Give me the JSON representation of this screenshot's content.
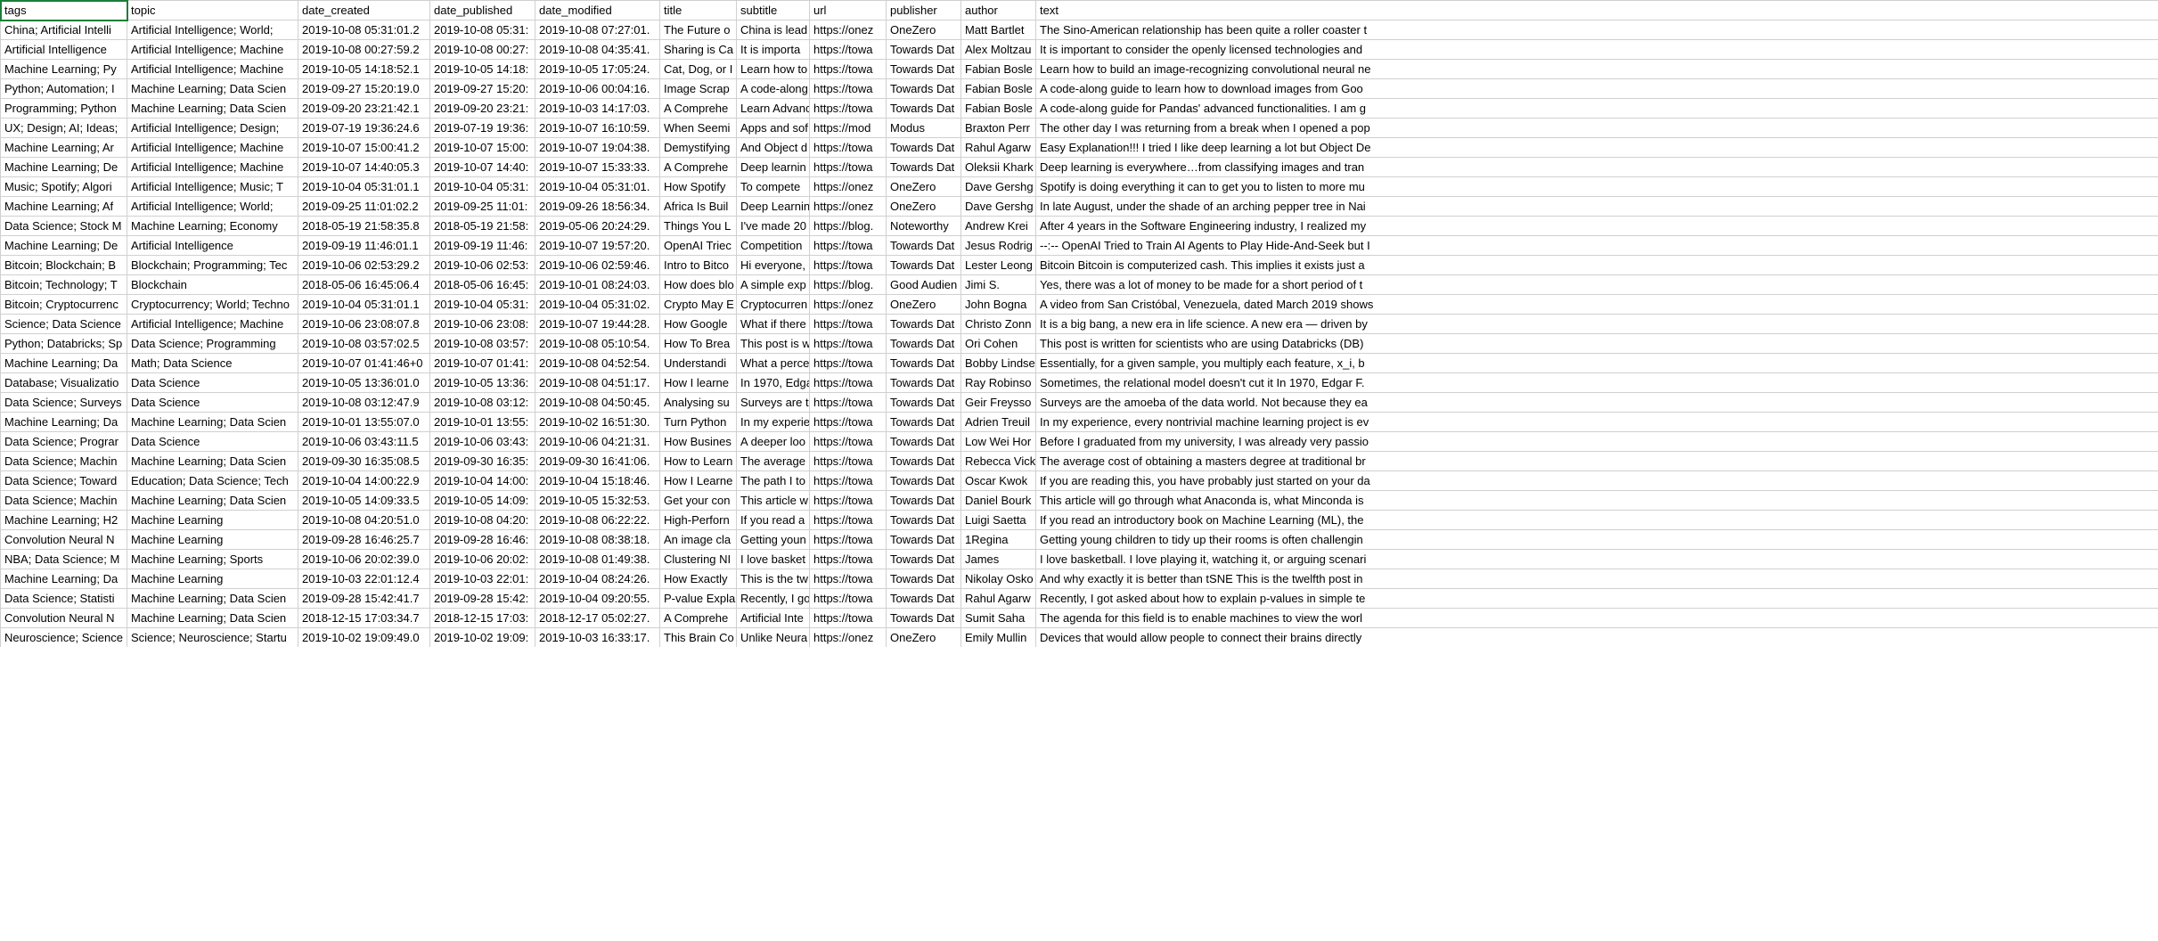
{
  "headers": {
    "tags": "tags",
    "topic": "topic",
    "date_created": "date_created",
    "date_published": "date_published",
    "date_modified": "date_modified",
    "title": "title",
    "subtitle": "subtitle",
    "url": "url",
    "publisher": "publisher",
    "author": "author",
    "text": "text"
  },
  "rows": [
    {
      "tags": "China; Artificial Intelli",
      "topic": "Artificial Intelligence; World;",
      "date_created": "2019-10-08 05:31:01.2",
      "date_published": "2019-10-08 05:31:",
      "date_modified": "2019-10-08 07:27:01.",
      "title": "The Future o",
      "subtitle": "China is lead",
      "url": "https://onez",
      "publisher": "OneZero",
      "author": "Matt Bartlet",
      "text": "The Sino-American relationship has been quite a roller coaster t"
    },
    {
      "tags": "Artificial Intelligence",
      "topic": "Artificial Intelligence; Machine",
      "date_created": "2019-10-08 00:27:59.2",
      "date_published": "2019-10-08 00:27:",
      "date_modified": "2019-10-08 04:35:41.",
      "title": "Sharing is Ca",
      "subtitle": "It is importa",
      "url": "https://towa",
      "publisher": "Towards Dat",
      "author": "Alex Moltzau",
      "text": "It is important to consider the openly licensed technologies and"
    },
    {
      "tags": "Machine Learning; Py",
      "topic": "Artificial Intelligence; Machine",
      "date_created": "2019-10-05 14:18:52.1",
      "date_published": "2019-10-05 14:18:",
      "date_modified": "2019-10-05 17:05:24.",
      "title": "Cat, Dog, or I",
      "subtitle": "Learn how to",
      "url": "https://towa",
      "publisher": "Towards Dat",
      "author": "Fabian Bosle",
      "text": "Learn how to build an image-recognizing convolutional neural ne"
    },
    {
      "tags": "Python; Automation; I",
      "topic": "Machine Learning; Data Scien",
      "date_created": "2019-09-27 15:20:19.0",
      "date_published": "2019-09-27 15:20:",
      "date_modified": "2019-10-06 00:04:16.",
      "title": "Image Scrap",
      "subtitle": "A code-along",
      "url": "https://towa",
      "publisher": "Towards Dat",
      "author": "Fabian Bosle",
      "text": "A code-along guide to learn how to download images from Goo"
    },
    {
      "tags": "Programming; Python",
      "topic": "Machine Learning; Data Scien",
      "date_created": "2019-09-20 23:21:42.1",
      "date_published": "2019-09-20 23:21:",
      "date_modified": "2019-10-03 14:17:03.",
      "title": "A Comprehe",
      "subtitle": "Learn Advanc",
      "url": "https://towa",
      "publisher": "Towards Dat",
      "author": "Fabian Bosle",
      "text": "A code-along guide for Pandas' advanced functionalities. I am g"
    },
    {
      "tags": "UX; Design; AI; Ideas;",
      "topic": "Artificial Intelligence; Design;",
      "date_created": "2019-07-19 19:36:24.6",
      "date_published": "2019-07-19 19:36:",
      "date_modified": "2019-10-07 16:10:59.",
      "title": "When Seemi",
      "subtitle": "Apps and sof",
      "url": "https://mod",
      "publisher": "Modus",
      "author": "Braxton Perr",
      "text": "The other day I was returning from a break when I opened a pop"
    },
    {
      "tags": "Machine Learning; Ar",
      "topic": "Artificial Intelligence; Machine",
      "date_created": "2019-10-07 15:00:41.2",
      "date_published": "2019-10-07 15:00:",
      "date_modified": "2019-10-07 19:04:38.",
      "title": "Demystifying",
      "subtitle": "And Object d",
      "url": "https://towa",
      "publisher": "Towards Dat",
      "author": "Rahul Agarw",
      "text": "Easy Explanation!!! I tried I like deep learning a lot but Object De"
    },
    {
      "tags": "Machine Learning; De",
      "topic": "Artificial Intelligence; Machine",
      "date_created": "2019-10-07 14:40:05.3",
      "date_published": "2019-10-07 14:40:",
      "date_modified": "2019-10-07 15:33:33.",
      "title": "A Comprehe",
      "subtitle": "Deep learnin",
      "url": "https://towa",
      "publisher": "Towards Dat",
      "author": "Oleksii Khark",
      "text": "Deep learning is everywhere…from classifying images and tran"
    },
    {
      "tags": "Music; Spotify; Algori",
      "topic": "Artificial Intelligence; Music; T",
      "date_created": "2019-10-04 05:31:01.1",
      "date_published": "2019-10-04 05:31:",
      "date_modified": "2019-10-04 05:31:01.",
      "title": "How Spotify",
      "subtitle": "To compete",
      "url": "https://onez",
      "publisher": "OneZero",
      "author": "Dave Gershg",
      "text": "Spotify is doing everything it can to get you to listen to more mu"
    },
    {
      "tags": "Machine Learning; Af",
      "topic": "Artificial Intelligence; World;",
      "date_created": "2019-09-25 11:01:02.2",
      "date_published": "2019-09-25 11:01:",
      "date_modified": "2019-09-26 18:56:34.",
      "title": "Africa Is Buil",
      "subtitle": "Deep Learnin",
      "url": "https://onez",
      "publisher": "OneZero",
      "author": "Dave Gershg",
      "text": "In late August, under the shade of an arching pepper tree in Nai"
    },
    {
      "tags": "Data Science; Stock M",
      "topic": "Machine Learning; Economy",
      "date_created": "2018-05-19 21:58:35.8",
      "date_published": "2018-05-19 21:58:",
      "date_modified": "2019-05-06 20:24:29.",
      "title": "Things You L",
      "subtitle": "I've made 20",
      "url": "https://blog.",
      "publisher": "Noteworthy",
      "author": "Andrew Krei",
      "text": "After 4 years in the Software Engineering industry, I realized my"
    },
    {
      "tags": "Machine Learning; De",
      "topic": "Artificial Intelligence",
      "date_created": "2019-09-19 11:46:01.1",
      "date_published": "2019-09-19 11:46:",
      "date_modified": "2019-10-07 19:57:20.",
      "title": "OpenAI Triec",
      "subtitle": "Competition",
      "url": "https://towa",
      "publisher": "Towards Dat",
      "author": "Jesus Rodrig",
      "text": "--:-- OpenAI Tried to Train AI Agents to Play Hide-And-Seek but I"
    },
    {
      "tags": "Bitcoin; Blockchain; B",
      "topic": "Blockchain; Programming; Tec",
      "date_created": "2019-10-06 02:53:29.2",
      "date_published": "2019-10-06 02:53:",
      "date_modified": "2019-10-06 02:59:46.",
      "title": "Intro to Bitco",
      "subtitle": "Hi everyone,",
      "url": "https://towa",
      "publisher": "Towards Dat",
      "author": "Lester Leong",
      "text": "Bitcoin Bitcoin is computerized cash. This implies it exists just a"
    },
    {
      "tags": "Bitcoin; Technology; T",
      "topic": "Blockchain",
      "date_created": "2018-05-06 16:45:06.4",
      "date_published": "2018-05-06 16:45:",
      "date_modified": "2019-10-01 08:24:03.",
      "title": "How does blo",
      "subtitle": "A simple exp",
      "url": "https://blog.",
      "publisher": "Good Audien",
      "author": "Jimi S.",
      "text": "Yes, there was a lot of money to be made for a short period of t"
    },
    {
      "tags": "Bitcoin; Cryptocurrenc",
      "topic": "Cryptocurrency; World; Techno",
      "date_created": "2019-10-04 05:31:01.1",
      "date_published": "2019-10-04 05:31:",
      "date_modified": "2019-10-04 05:31:02.",
      "title": "Crypto May E",
      "subtitle": "Cryptocurren",
      "url": "https://onez",
      "publisher": "OneZero",
      "author": "John Bogna",
      "text": "A video from San Cristóbal, Venezuela, dated March 2019 shows"
    },
    {
      "tags": "Science; Data Science",
      "topic": "Artificial Intelligence; Machine",
      "date_created": "2019-10-06 23:08:07.8",
      "date_published": "2019-10-06 23:08:",
      "date_modified": "2019-10-07 19:44:28.",
      "title": "How Google",
      "subtitle": "What if there",
      "url": "https://towa",
      "publisher": "Towards Dat",
      "author": "Christo Zonn",
      "text": "It is a big bang, a new era in life science. A new era — driven by"
    },
    {
      "tags": "Python; Databricks; Sp",
      "topic": "Data Science; Programming",
      "date_created": "2019-10-08 03:57:02.5",
      "date_published": "2019-10-08 03:57:",
      "date_modified": "2019-10-08 05:10:54.",
      "title": "How To Brea",
      "subtitle": "This post is w",
      "url": "https://towa",
      "publisher": "Towards Dat",
      "author": "Ori Cohen",
      "text": "This post is written for scientists who are using Databricks (DB)"
    },
    {
      "tags": "Machine Learning; Da",
      "topic": "Math; Data Science",
      "date_created": "2019-10-07 01:41:46+0",
      "date_published": "2019-10-07 01:41:",
      "date_modified": "2019-10-08 04:52:54.",
      "title": "Understandi",
      "subtitle": "What a perce",
      "url": "https://towa",
      "publisher": "Towards Dat",
      "author": "Bobby Lindse",
      "text": "Essentially, for a given sample, you multiply each feature, x_i, b"
    },
    {
      "tags": "Database; Visualizatio",
      "topic": "Data Science",
      "date_created": "2019-10-05 13:36:01.0",
      "date_published": "2019-10-05 13:36:",
      "date_modified": "2019-10-08 04:51:17.",
      "title": "How I learne",
      "subtitle": "In 1970, Edga",
      "url": "https://towa",
      "publisher": "Towards Dat",
      "author": "Ray Robinso",
      "text": "Sometimes, the relational model doesn't cut it In 1970, Edgar F."
    },
    {
      "tags": "Data Science; Surveys",
      "topic": "Data Science",
      "date_created": "2019-10-08 03:12:47.9",
      "date_published": "2019-10-08 03:12:",
      "date_modified": "2019-10-08 04:50:45.",
      "title": "Analysing su",
      "subtitle": "Surveys are t",
      "url": "https://towa",
      "publisher": "Towards Dat",
      "author": "Geir Freysso",
      "text": "Surveys are the amoeba of the data world. Not because they ea"
    },
    {
      "tags": "Machine Learning; Da",
      "topic": "Machine Learning; Data Scien",
      "date_created": "2019-10-01 13:55:07.0",
      "date_published": "2019-10-01 13:55:",
      "date_modified": "2019-10-02 16:51:30.",
      "title": "Turn Python",
      "subtitle": "In my experie",
      "url": "https://towa",
      "publisher": "Towards Dat",
      "author": "Adrien Treuil",
      "text": "In my experience, every nontrivial machine learning project is ev"
    },
    {
      "tags": "Data Science; Prograr",
      "topic": "Data Science",
      "date_created": "2019-10-06 03:43:11.5",
      "date_published": "2019-10-06 03:43:",
      "date_modified": "2019-10-06 04:21:31.",
      "title": "How Busines",
      "subtitle": "A deeper loo",
      "url": "https://towa",
      "publisher": "Towards Dat",
      "author": "Low Wei Hor",
      "text": "Before I graduated from my university, I was already very passio"
    },
    {
      "tags": "Data Science; Machin",
      "topic": "Machine Learning; Data Scien",
      "date_created": "2019-09-30 16:35:08.5",
      "date_published": "2019-09-30 16:35:",
      "date_modified": "2019-09-30 16:41:06.",
      "title": "How to Learn",
      "subtitle": "The average",
      "url": "https://towa",
      "publisher": "Towards Dat",
      "author": "Rebecca Vick",
      "text": "The average cost of obtaining a masters degree at traditional br"
    },
    {
      "tags": "Data Science; Toward",
      "topic": "Education; Data Science; Tech",
      "date_created": "2019-10-04 14:00:22.9",
      "date_published": "2019-10-04 14:00:",
      "date_modified": "2019-10-04 15:18:46.",
      "title": "How I Learne",
      "subtitle": "The path I to",
      "url": "https://towa",
      "publisher": "Towards Dat",
      "author": "Oscar Kwok",
      "text": "If you are reading this, you have probably just started on your da"
    },
    {
      "tags": "Data Science; Machin",
      "topic": "Machine Learning; Data Scien",
      "date_created": "2019-10-05 14:09:33.5",
      "date_published": "2019-10-05 14:09:",
      "date_modified": "2019-10-05 15:32:53.",
      "title": "Get your con",
      "subtitle": "This article w",
      "url": "https://towa",
      "publisher": "Towards Dat",
      "author": "Daniel Bourk",
      "text": "This article will go through what Anaconda is, what Minconda is"
    },
    {
      "tags": "Machine Learning; H2",
      "topic": "Machine Learning",
      "date_created": "2019-10-08 04:20:51.0",
      "date_published": "2019-10-08 04:20:",
      "date_modified": "2019-10-08 06:22:22.",
      "title": "High-Perforn",
      "subtitle": "If you read a",
      "url": "https://towa",
      "publisher": "Towards Dat",
      "author": "Luigi Saetta",
      "text": "If you read an introductory book on Machine Learning (ML), the"
    },
    {
      "tags": "Convolution Neural N",
      "topic": "Machine Learning",
      "date_created": "2019-09-28 16:46:25.7",
      "date_published": "2019-09-28 16:46:",
      "date_modified": "2019-10-08 08:38:18.",
      "title": "An image cla",
      "subtitle": "Getting youn",
      "url": "https://towa",
      "publisher": "Towards Dat",
      "author": "1Regina",
      "text": "Getting young children to tidy up their rooms is often challengin"
    },
    {
      "tags": "NBA; Data Science; M",
      "topic": "Machine Learning; Sports",
      "date_created": "2019-10-06 20:02:39.0",
      "date_published": "2019-10-06 20:02:",
      "date_modified": "2019-10-08 01:49:38.",
      "title": "Clustering NI",
      "subtitle": "I love basket",
      "url": "https://towa",
      "publisher": "Towards Dat",
      "author": "James",
      "text": "I love basketball. I love playing it, watching it, or arguing scenari"
    },
    {
      "tags": "Machine Learning; Da",
      "topic": "Machine Learning",
      "date_created": "2019-10-03 22:01:12.4",
      "date_published": "2019-10-03 22:01:",
      "date_modified": "2019-10-04 08:24:26.",
      "title": "How Exactly",
      "subtitle": "This is the tw",
      "url": "https://towa",
      "publisher": "Towards Dat",
      "author": "Nikolay Osko",
      "text": "And why exactly it is better than tSNE This is the twelfth post in"
    },
    {
      "tags": "Data Science; Statisti",
      "topic": "Machine Learning; Data Scien",
      "date_created": "2019-09-28 15:42:41.7",
      "date_published": "2019-09-28 15:42:",
      "date_modified": "2019-10-04 09:20:55.",
      "title": "P-value Expla",
      "subtitle": "Recently, I go",
      "url": "https://towa",
      "publisher": "Towards Dat",
      "author": "Rahul Agarw",
      "text": "Recently, I got asked about how to explain p-values in simple te"
    },
    {
      "tags": "Convolution Neural N",
      "topic": "Machine Learning; Data Scien",
      "date_created": "2018-12-15 17:03:34.7",
      "date_published": "2018-12-15 17:03:",
      "date_modified": "2018-12-17 05:02:27.",
      "title": "A Comprehe",
      "subtitle": "Artificial Inte",
      "url": "https://towa",
      "publisher": "Towards Dat",
      "author": "Sumit Saha",
      "text": "The agenda for this field is to enable machines to view the worl"
    },
    {
      "tags": "Neuroscience; Science",
      "topic": "Science; Neuroscience; Startu",
      "date_created": "2019-10-02 19:09:49.0",
      "date_published": "2019-10-02 19:09:",
      "date_modified": "2019-10-03 16:33:17.",
      "title": "This Brain Co",
      "subtitle": "Unlike Neura",
      "url": "https://onez",
      "publisher": "OneZero",
      "author": "Emily Mullin",
      "text": "Devices that would allow people to connect their brains directly"
    }
  ]
}
